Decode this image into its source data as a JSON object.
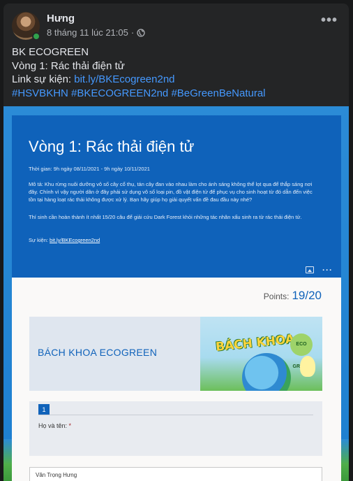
{
  "post": {
    "author": "Hưng",
    "timestamp": "8 tháng 11 lúc 21:05",
    "separator": "·",
    "more_label": "•••",
    "line1": "BK ECOGREEN",
    "line2": "Vòng 1: Rác thải điện tử",
    "line3_prefix": "Link sự kiện: ",
    "line3_link": "bit.ly/BKEcogreen2nd",
    "hashtags": [
      "#HSVBKHN",
      "#BKECOGREEN2nd",
      "#BeGreenBeNatural"
    ]
  },
  "form": {
    "title": "Vòng 1: Rác thải điện tử",
    "time": "Thời gian: 9h ngày 08/11/2021 - 9h ngày 10/11/2021",
    "description": "Mô tả: Khu rừng nuôi dưỡng vô số cây cổ thụ, tán cây đan vào nhau làm cho ánh sáng không thể lọt qua để thắp sáng nơi đây. Chính vì vậy người dân ở đây phải sử dụng vô số loại pin, đồ vật điện tử để phục vụ cho sinh hoạt từ đó dẫn đến việc tồn tại hàng loạt rác thải không được xử lý. Bạn hãy giúp họ giải quyết vấn đề đau đầu này nhé?",
    "rule": "Thí sinh cần hoàn thành ít nhất 15/20 câu để giải cứu Dark Forest khỏi những tác nhân xấu sinh ra từ rác thải điện tử.",
    "event_prefix": "Sự kiện: ",
    "event_link": "bit.ly/BKEcogreen2nd",
    "dots": "···",
    "points_label": "Points:",
    "points_value": "19/20",
    "card_title": "BÁCH KHOA ECOGREEN",
    "art_title": "BÁCH KHOA",
    "art_eco": "ECO GREEN",
    "question_number": "1",
    "question_label": "Họ và tên:",
    "required_mark": "*",
    "answer_value": "Văn Trọng Hưng"
  },
  "colors": {
    "accent": "#0f62ba",
    "link": "#4599ff",
    "background": "#242526"
  },
  "icons": [
    "globe-icon",
    "more-icon",
    "image-icon",
    "more-icon"
  ]
}
